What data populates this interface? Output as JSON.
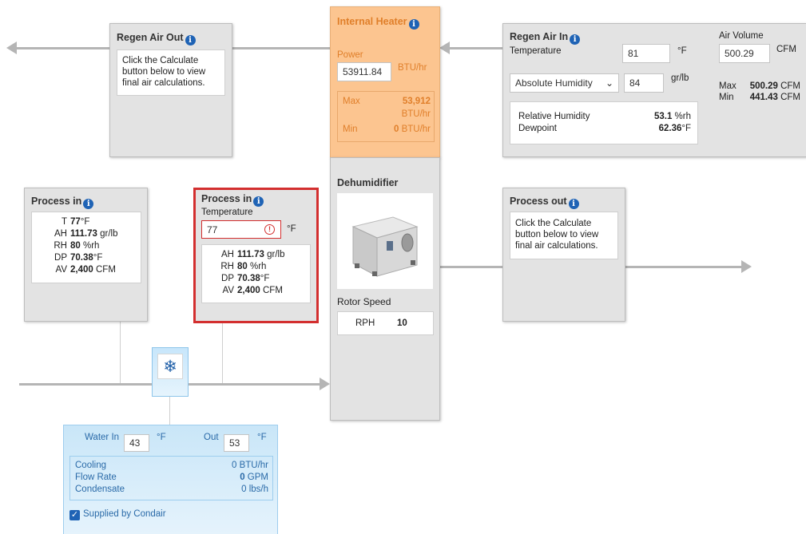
{
  "regen_out": {
    "title": "Regen Air Out",
    "message": "Click the Calculate button below to view final air calculations."
  },
  "heater": {
    "title": "Internal Heater",
    "power_label": "Power",
    "power_value": "53911.84",
    "power_unit": "BTU/hr",
    "max_label": "Max",
    "max_value": "53,912",
    "max_unit": "BTU/hr",
    "min_label": "Min",
    "min_value": "0",
    "min_unit": "BTU/hr"
  },
  "regen_in": {
    "title": "Regen Air In",
    "temperature_label": "Temperature",
    "temperature_value": "81",
    "temperature_unit": "°F",
    "air_volume_label": "Air Volume",
    "air_volume_value": "500.29",
    "air_volume_unit": "CFM",
    "humidity_select": "Absolute Humidity",
    "humidity_value": "84",
    "humidity_unit": "gr/lb",
    "max_label": "Max",
    "max_value": "500.29",
    "max_unit": "CFM",
    "min_label": "Min",
    "min_value": "441.43",
    "min_unit": "CFM",
    "rh_label": "Relative Humidity",
    "rh_value": "53.1",
    "rh_unit": "%rh",
    "dewpoint_label": "Dewpoint",
    "dewpoint_value": "62.36",
    "dewpoint_unit": "°F"
  },
  "process_in_1": {
    "title": "Process in",
    "t_label": "T",
    "t_value": "77",
    "t_unit": "°F",
    "ah_label": "AH",
    "ah_value": "111.73",
    "ah_unit": "gr/lb",
    "rh_label": "RH",
    "rh_value": "80",
    "rh_unit": "%rh",
    "dp_label": "DP",
    "dp_value": "70.38",
    "dp_unit": "°F",
    "av_label": "AV",
    "av_value": "2,400",
    "av_unit": "CFM"
  },
  "process_in_2": {
    "title": "Process in",
    "temperature_label": "Temperature",
    "temperature_value": "77",
    "temperature_unit": "°F",
    "ah_label": "AH",
    "ah_value": "111.73",
    "ah_unit": "gr/lb",
    "rh_label": "RH",
    "rh_value": "80",
    "rh_unit": "%rh",
    "dp_label": "DP",
    "dp_value": "70.38",
    "dp_unit": "°F",
    "av_label": "AV",
    "av_value": "2,400",
    "av_unit": "CFM",
    "error_color": "#d32f2f"
  },
  "dehumidifier": {
    "title": "Dehumidifier",
    "rotor_label": "Rotor Speed",
    "rph_label": "RPH",
    "rph_value": "10"
  },
  "process_out": {
    "title": "Process out",
    "message": "Click the Calculate button below to view final air calculations."
  },
  "cooling": {
    "icon": "snowflake-icon",
    "water_in_label": "Water In",
    "water_in_value": "43",
    "water_in_unit": "°F",
    "out_label": "Out",
    "out_value": "53",
    "out_unit": "°F",
    "cooling_label": "Cooling",
    "cooling_value": "0",
    "cooling_unit": "BTU/hr",
    "flow_label": "Flow Rate",
    "flow_value": "0",
    "flow_unit": "GPM",
    "condensate_label": "Condensate",
    "condensate_value": "0",
    "condensate_unit": "lbs/h",
    "supplied_label": "Supplied by Condair",
    "supplied_checked": true
  },
  "colors": {
    "info": "#1f63b5",
    "heater_bg": "#fcc590",
    "heater_text": "#e07f2a",
    "cooling_bg": "#cfe8f8",
    "error": "#d32f2f"
  }
}
